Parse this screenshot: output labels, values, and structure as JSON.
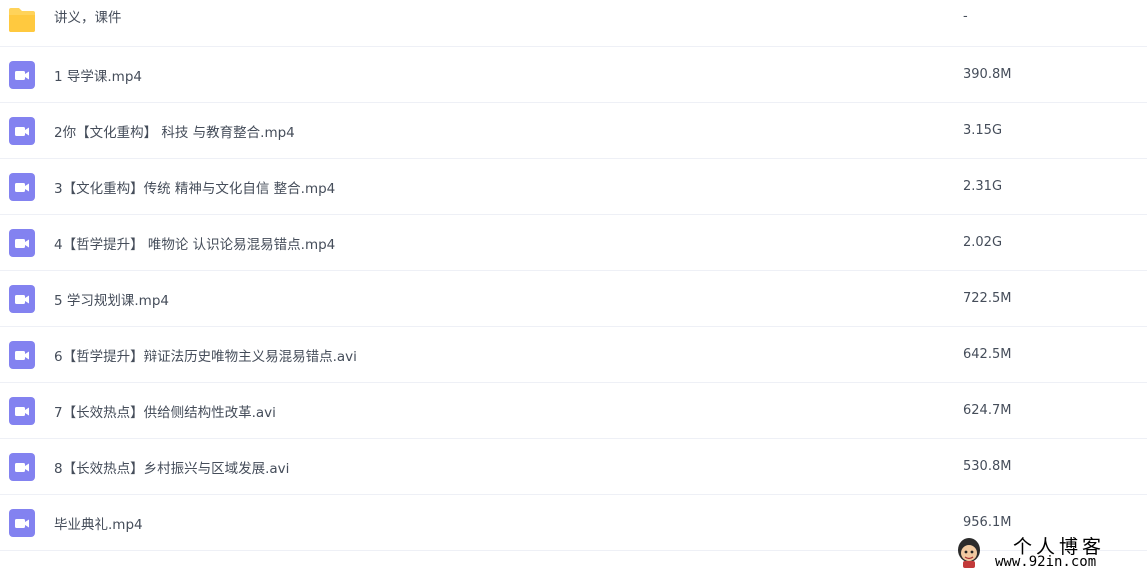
{
  "files": [
    {
      "name": "讲义，课件",
      "size": "-",
      "type": "folder"
    },
    {
      "name": "1 导学课.mp4",
      "size": "390.8M",
      "type": "video"
    },
    {
      "name": "2你【文化重构】 科技 与教育整合.mp4",
      "size": "3.15G",
      "type": "video"
    },
    {
      "name": "3【文化重构】传统 精神与文化自信 整合.mp4",
      "size": "2.31G",
      "type": "video"
    },
    {
      "name": "4【哲学提升】 唯物论 认识论易混易错点.mp4",
      "size": "2.02G",
      "type": "video"
    },
    {
      "name": "5 学习规划课.mp4",
      "size": "722.5M",
      "type": "video"
    },
    {
      "name": "6【哲学提升】辩证法历史唯物主义易混易错点.avi",
      "size": "642.5M",
      "type": "video"
    },
    {
      "name": "7【长效热点】供给侧结构性改革.avi",
      "size": "624.7M",
      "type": "video"
    },
    {
      "name": "8【长效热点】乡村振兴与区域发展.avi",
      "size": "530.8M",
      "type": "video"
    },
    {
      "name": "毕业典礼.mp4",
      "size": "956.1M",
      "type": "video"
    }
  ],
  "icons": {
    "folder": "folder-icon",
    "video": "video-file-icon"
  },
  "colors": {
    "folder": "#ffd35a",
    "video": "#8382f0",
    "text": "#454d5a",
    "divider": "#eef0f6"
  },
  "watermark": {
    "title": "个人博客",
    "url": "www.92in.com"
  }
}
